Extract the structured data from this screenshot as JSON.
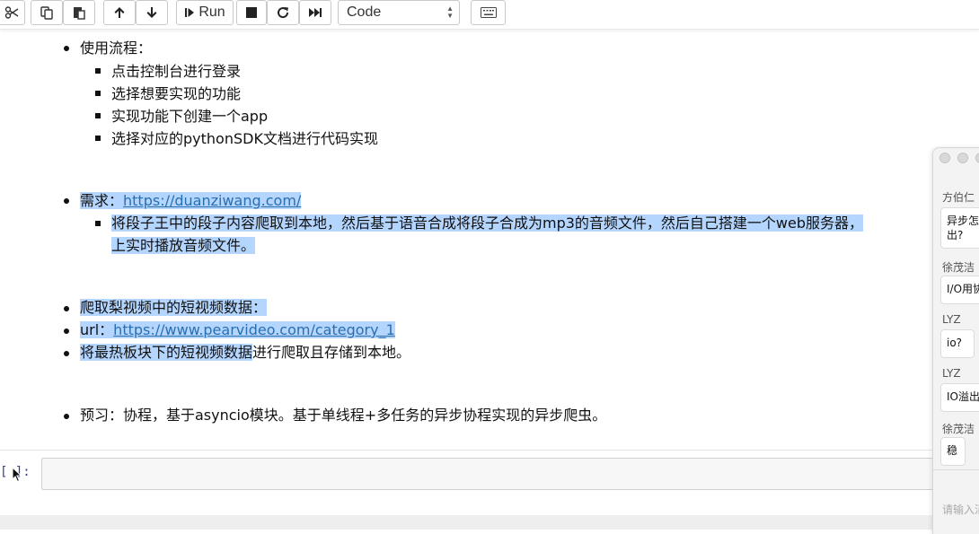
{
  "toolbar": {
    "cut_icon": "scissors-icon",
    "copy_icon": "copy-icon",
    "paste_icon": "paste-icon",
    "move_up_icon": "arrow-up-icon",
    "move_down_icon": "arrow-down-icon",
    "run_label": "Run",
    "interrupt_icon": "stop-icon",
    "restart_icon": "restart-icon",
    "run_all_icon": "fast-forward-icon",
    "cell_type": "Code",
    "keyboard_icon": "keyboard-icon"
  },
  "notebook": {
    "usage_flow": {
      "title": "使用流程：",
      "steps": [
        "点击控制台进行登录",
        "选择想要实现的功能",
        "实现功能下创建一个app",
        "选择对应的pythonSDK文档进行代码实现"
      ]
    },
    "requirement": {
      "label": "需求：",
      "link": "https://duanziwang.com/",
      "detail_line1": "将段子王中的段子内容爬取到本地，然后基于语音合成将段子合成为mp3的音频文件，然后自己搭建一个web服务器，",
      "detail_line2": "上实时播放音频文件。"
    },
    "pear": {
      "item1": "爬取梨视频中的短视频数据：",
      "url_label": "url：",
      "url_link": "https://www.pearvideo.com/category_1",
      "item3_highlighted": "将最热板块下的短视频数据",
      "item3_rest": "进行爬取且存储到本地。"
    },
    "preview": "预习：协程，基于asyncio模块。基于单线程+多任务的异步协程实现的异步爬虫。",
    "prompt": "[ ]:"
  },
  "chat": {
    "messages": [
      {
        "name": "方伯仁",
        "text": "异步怎\n出?"
      },
      {
        "name": "徐茂洁",
        "text": "I/O用协"
      },
      {
        "name": "LYZ",
        "text": "io?"
      },
      {
        "name": "LYZ",
        "text": "IO溢出"
      },
      {
        "name": "徐茂洁",
        "text": "稳"
      }
    ],
    "input_placeholder": "请输入消息"
  }
}
